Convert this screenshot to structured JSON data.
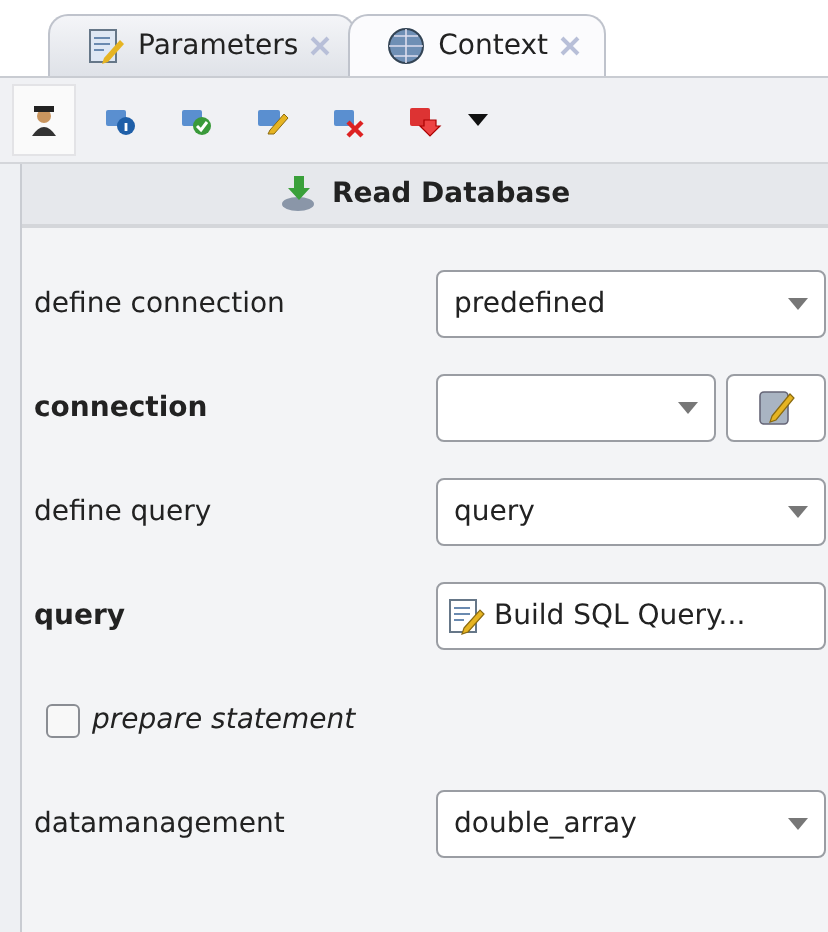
{
  "tabs": [
    {
      "label": "Parameters",
      "selected": false
    },
    {
      "label": "Context",
      "selected": true
    }
  ],
  "toolbar": [
    {
      "kind": "expert",
      "selected": true
    },
    {
      "kind": "info",
      "selected": false
    },
    {
      "kind": "check",
      "selected": false
    },
    {
      "kind": "edit",
      "selected": false
    },
    {
      "kind": "delete",
      "selected": false
    },
    {
      "kind": "import",
      "selected": false
    }
  ],
  "operator": {
    "title": "Read Database"
  },
  "parameters": [
    {
      "kind": "select",
      "label": "define connection",
      "bold": false,
      "value": "predefined"
    },
    {
      "kind": "select_button",
      "label": "connection",
      "bold": true
    },
    {
      "kind": "select",
      "label": "define query",
      "bold": false,
      "value": "query"
    },
    {
      "kind": "button",
      "label": "query",
      "bold": true,
      "value": "Build SQL Query..."
    },
    {
      "kind": "checkbox",
      "label": "prepare statement",
      "checked": false
    },
    {
      "kind": "select",
      "label": "datamanagement",
      "bold": false,
      "value": "double_array"
    }
  ]
}
